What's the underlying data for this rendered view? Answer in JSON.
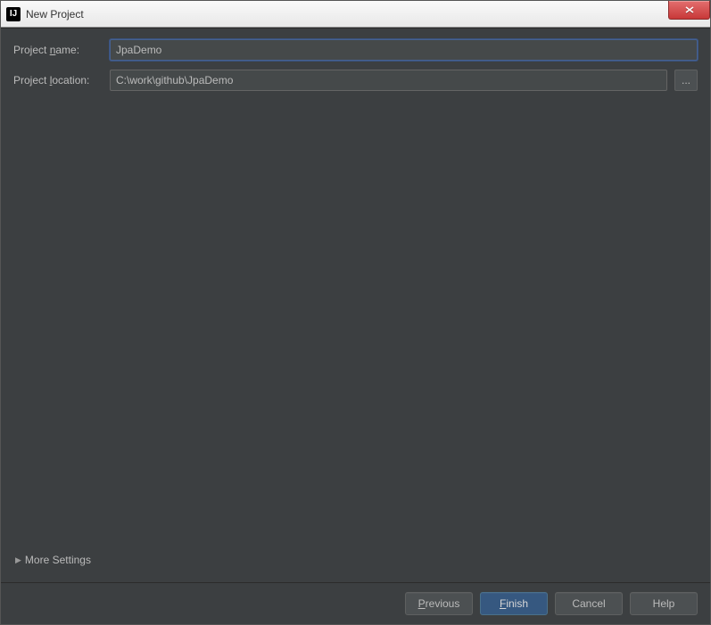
{
  "window": {
    "title": "New Project"
  },
  "form": {
    "project_name_label": "Project name:",
    "project_name_value": "JpaDemo",
    "project_location_label": "Project location:",
    "project_location_value": "C:\\work\\github\\JpaDemo",
    "browse_label": "..."
  },
  "more_settings": {
    "label": "More Settings"
  },
  "footer": {
    "previous": "Previous",
    "finish": "Finish",
    "cancel": "Cancel",
    "help": "Help"
  }
}
